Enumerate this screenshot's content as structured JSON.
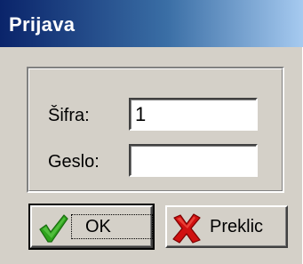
{
  "window": {
    "title": "Prijava"
  },
  "form": {
    "code_label": "Šifra:",
    "code_value": "1",
    "password_label": "Geslo:",
    "password_value": ""
  },
  "buttons": {
    "ok_label": "OK",
    "cancel_label": "Preklic"
  },
  "icons": {
    "ok": "checkmark-icon",
    "cancel": "red-x-icon"
  },
  "colors": {
    "title_gradient_start": "#0a246a",
    "title_gradient_end": "#a6caf0",
    "dialog_face": "#d4d0c8",
    "check_green": "#2ea31c",
    "cross_red": "#d01010"
  }
}
